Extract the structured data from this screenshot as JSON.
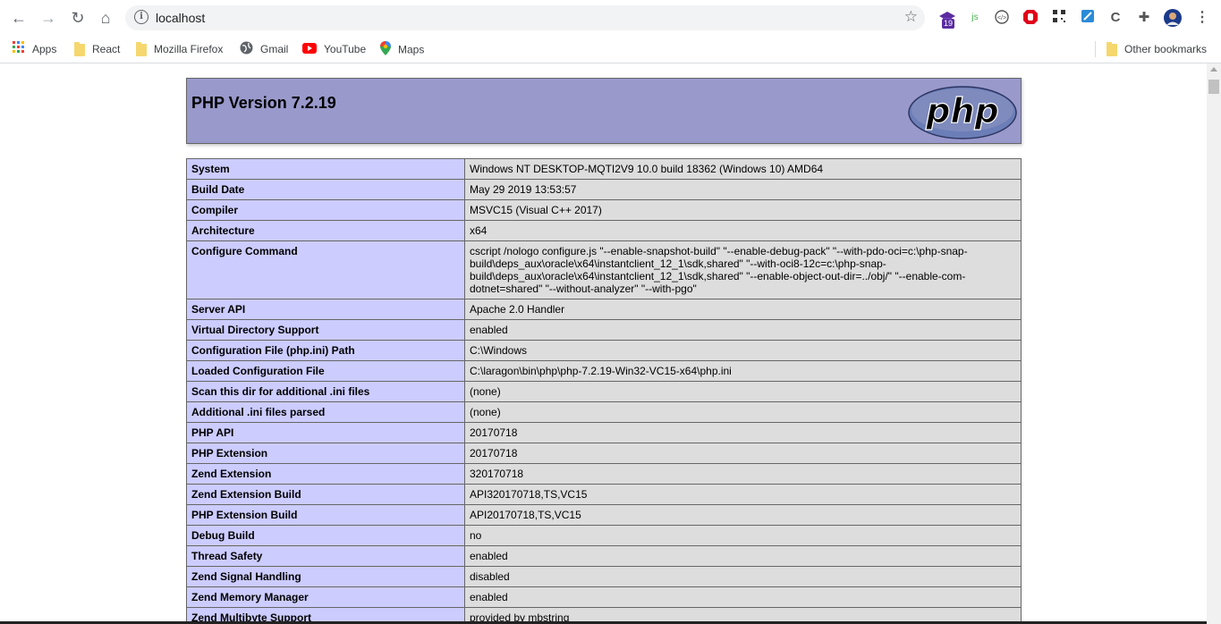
{
  "browser": {
    "url": "localhost",
    "extension_badge": "19",
    "bookmarks": [
      {
        "label": "Apps",
        "icon": "apps-grid-icon"
      },
      {
        "label": "React",
        "icon": "folder-icon"
      },
      {
        "label": "Mozilla Firefox",
        "icon": "folder-icon"
      },
      {
        "label": "Gmail",
        "icon": "globe-icon"
      },
      {
        "label": "YouTube",
        "icon": "youtube-icon"
      },
      {
        "label": "Maps",
        "icon": "maps-pin-icon"
      }
    ],
    "other_bookmarks": "Other bookmarks"
  },
  "phpinfo": {
    "title": "PHP Version 7.2.19",
    "logo_text": "php",
    "rows": [
      {
        "key": "System",
        "value": "Windows NT DESKTOP-MQTI2V9 10.0 build 18362 (Windows 10) AMD64"
      },
      {
        "key": "Build Date",
        "value": "May 29 2019 13:53:57"
      },
      {
        "key": "Compiler",
        "value": "MSVC15 (Visual C++ 2017)"
      },
      {
        "key": "Architecture",
        "value": "x64"
      },
      {
        "key": "Configure Command",
        "value": "cscript /nologo configure.js \"--enable-snapshot-build\" \"--enable-debug-pack\" \"--with-pdo-oci=c:\\php-snap-build\\deps_aux\\oracle\\x64\\instantclient_12_1\\sdk,shared\" \"--with-oci8-12c=c:\\php-snap-build\\deps_aux\\oracle\\x64\\instantclient_12_1\\sdk,shared\" \"--enable-object-out-dir=../obj/\" \"--enable-com-dotnet=shared\" \"--without-analyzer\" \"--with-pgo\""
      },
      {
        "key": "Server API",
        "value": "Apache 2.0 Handler"
      },
      {
        "key": "Virtual Directory Support",
        "value": "enabled"
      },
      {
        "key": "Configuration File (php.ini) Path",
        "value": "C:\\Windows"
      },
      {
        "key": "Loaded Configuration File",
        "value": "C:\\laragon\\bin\\php\\php-7.2.19-Win32-VC15-x64\\php.ini"
      },
      {
        "key": "Scan this dir for additional .ini files",
        "value": "(none)"
      },
      {
        "key": "Additional .ini files parsed",
        "value": "(none)"
      },
      {
        "key": "PHP API",
        "value": "20170718"
      },
      {
        "key": "PHP Extension",
        "value": "20170718"
      },
      {
        "key": "Zend Extension",
        "value": "320170718"
      },
      {
        "key": "Zend Extension Build",
        "value": "API320170718,TS,VC15"
      },
      {
        "key": "PHP Extension Build",
        "value": "API20170718,TS,VC15"
      },
      {
        "key": "Debug Build",
        "value": "no"
      },
      {
        "key": "Thread Safety",
        "value": "enabled"
      },
      {
        "key": "Zend Signal Handling",
        "value": "disabled"
      },
      {
        "key": "Zend Memory Manager",
        "value": "enabled"
      },
      {
        "key": "Zend Multibyte Support",
        "value": "provided by mbstring"
      }
    ]
  },
  "colors": {
    "header_bg": "#9999cc",
    "key_bg": "#ccccff",
    "value_bg": "#dddddd"
  }
}
